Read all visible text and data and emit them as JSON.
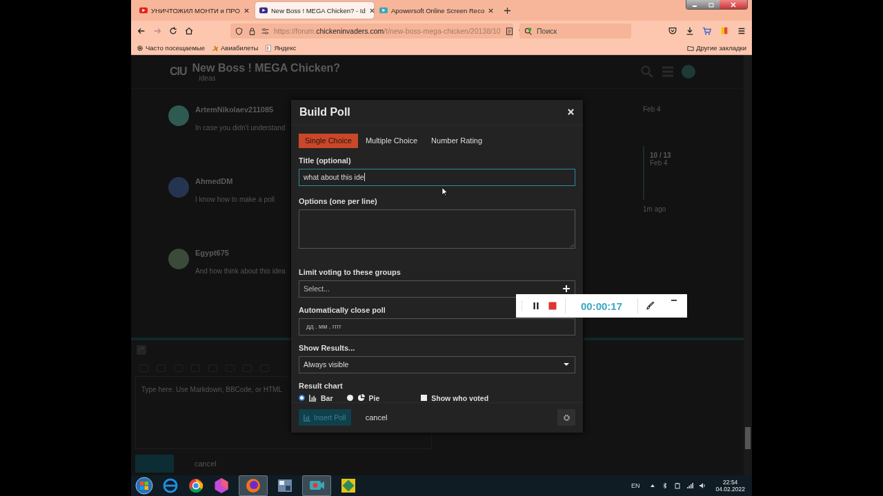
{
  "browser": {
    "tabs": [
      {
        "title": "УНИЧТОЖИЛ МОНТИ и ПРО",
        "selected": false,
        "kind": "video"
      },
      {
        "title": "New Boss ! MEGA Chicken? - Id",
        "selected": true,
        "kind": "forum"
      },
      {
        "title": "Apowersoft Online Screen Reco",
        "selected": false,
        "kind": "recorder"
      }
    ],
    "url": {
      "scheme": "https://forum.",
      "domain": "chickeninvaders.com",
      "path": "/t/new-boss-mega-chicken/20138/10"
    },
    "search": {
      "placeholder": "Поиск"
    },
    "bookmarks": [
      {
        "label": "Часто посещаемые",
        "kind": "gear"
      },
      {
        "label": "Авиабилеты",
        "kind": "plane"
      },
      {
        "label": "Яндекс",
        "kind": "page"
      }
    ],
    "other_bookmarks": "Другие закладки"
  },
  "forum": {
    "logo": "CIU",
    "title": "New Boss ! MEGA Chicken?",
    "category": "ideas",
    "posts": [
      {
        "author": "ArtemNikolaev211085",
        "text": "In case you didn't understand",
        "color": "#2f5a52"
      },
      {
        "author": "AhmedDM",
        "text": "I know how to make a poll",
        "color": "#26354f"
      },
      {
        "author": "Egypt675",
        "text": "And how think about this idea",
        "color": "#3c4a3a"
      }
    ],
    "timeline": {
      "top_date": "Feb 4",
      "position": "10 / 13",
      "position_date": "Feb 4",
      "bottom_date": "1m ago"
    },
    "composer": {
      "placeholder": "Type here. Use Markdown, BBCode, or HTML",
      "cancel": "cancel"
    }
  },
  "poll": {
    "title": "Build Poll",
    "types": [
      {
        "label": "Single Choice",
        "selected": true
      },
      {
        "label": "Multiple Choice",
        "selected": false
      },
      {
        "label": "Number Rating",
        "selected": false
      }
    ],
    "title_label": "Title (optional)",
    "title_value": "what about this ide",
    "options_label": "Options (one per line)",
    "groups_label": "Limit voting to these groups",
    "groups_placeholder": "Select...",
    "close_label": "Automatically close poll",
    "date_placeholder": "дд . мм . гггг",
    "results_label": "Show Results...",
    "results_value": "Always visible",
    "chart_label": "Result chart",
    "chart_types": [
      {
        "label": "Bar",
        "selected": true,
        "kind": "bar"
      },
      {
        "label": "Pie",
        "selected": false,
        "kind": "pie"
      }
    ],
    "show_voters": {
      "label": "Show who voted",
      "checked": false
    },
    "insert_button": "Insert Poll",
    "cancel": "cancel"
  },
  "recorder": {
    "time": "00:00:17"
  },
  "taskbar": {
    "language": "EN",
    "time": "22:54",
    "date": "04.02.2022"
  }
}
